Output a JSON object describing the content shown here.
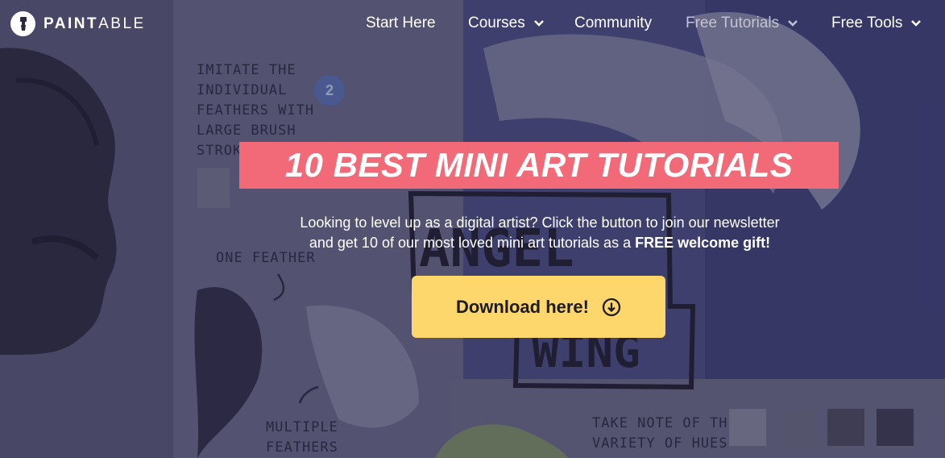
{
  "brand": {
    "name_bold": "PAINT",
    "name_light": "ABLE"
  },
  "nav": {
    "items": [
      {
        "label": "Start Here",
        "dropdown": false
      },
      {
        "label": "Courses",
        "dropdown": true
      },
      {
        "label": "Community",
        "dropdown": false
      },
      {
        "label": "Free Tutorials",
        "dropdown": true,
        "active": true
      },
      {
        "label": "Free Tools",
        "dropdown": true
      }
    ]
  },
  "hero": {
    "title": "10 BEST MINI ART TUTORIALS",
    "subtitle_line1": "Looking to level up as a digital artist? Click the button to join our newsletter",
    "subtitle_line2_prefix": "and get 10 of our most loved mini art tutorials as a ",
    "subtitle_line2_bold": "FREE welcome gift!",
    "cta_label": "Download here!",
    "cta_icon": "download-circle-icon"
  },
  "artwork": {
    "note1": "IMITATE THE\nINDIVIDUAL\nFEATHERS WITH\nLARGE BRUSH\nSTROKES",
    "note2": "ONE FEATHER",
    "note3": "MULTIPLE\nFEATHERS",
    "note4": "TAKE NOTE OF THE\nVARIETY OF HUES",
    "badge": "2",
    "label_word1": "ANGEL",
    "label_word2": "WING"
  },
  "colors": {
    "banner": "#f26a78",
    "cta": "#fdd66c",
    "nav_text": "#ffffff",
    "nav_active_text": "#c3c3d4"
  }
}
